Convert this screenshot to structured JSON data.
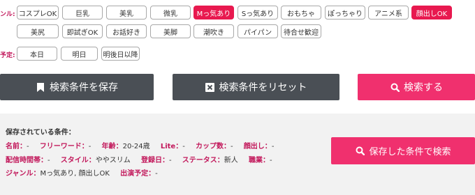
{
  "genre_label": "ンル:",
  "genre_chips": [
    {
      "label": "コスプレOK",
      "selected": false
    },
    {
      "label": "巨乳",
      "selected": false
    },
    {
      "label": "美乳",
      "selected": false
    },
    {
      "label": "微乳",
      "selected": false
    },
    {
      "label": "Mっ気あり",
      "selected": true
    },
    {
      "label": "Sっ気あり",
      "selected": false
    },
    {
      "label": "おもちゃ",
      "selected": false
    },
    {
      "label": "ぽっちゃり",
      "selected": false
    },
    {
      "label": "アニメ系",
      "selected": false
    },
    {
      "label": "顔出しOK",
      "selected": true
    },
    {
      "label": "美尻",
      "selected": false
    },
    {
      "label": "即試ぎOK",
      "selected": false
    },
    {
      "label": "お話好き",
      "selected": false
    },
    {
      "label": "美脚",
      "selected": false
    },
    {
      "label": "潮吹き",
      "selected": false
    },
    {
      "label": "パイパン",
      "selected": false
    },
    {
      "label": "待合せ歓迎",
      "selected": false
    }
  ],
  "schedule_label": "予定:",
  "schedule_chips": [
    {
      "label": "本日"
    },
    {
      "label": "明日"
    },
    {
      "label": "明後日以降"
    }
  ],
  "buttons": {
    "save": "検索条件を保存",
    "reset": "検索条件をリセット",
    "search": "検索する",
    "search_saved": "保存した条件で検索"
  },
  "saved": {
    "title": "保存されている条件：",
    "line1": [
      {
        "k": "名前：",
        "v": "-"
      },
      {
        "k": "フリーワード：",
        "v": "-"
      },
      {
        "k": "年齢：",
        "v": "20-24歳"
      },
      {
        "k": "Lite：",
        "v": "-"
      },
      {
        "k": "カップ数：",
        "v": "-"
      },
      {
        "k": "顔出し：",
        "v": "-"
      }
    ],
    "line2": [
      {
        "k": "配信時間帯：",
        "v": "-"
      },
      {
        "k": "スタイル：",
        "v": "ややスリム"
      },
      {
        "k": "登録日：",
        "v": "-"
      },
      {
        "k": "ステータス：",
        "v": "新人"
      },
      {
        "k": "職業：",
        "v": "-"
      }
    ],
    "line3": [
      {
        "k": "ジャンル：",
        "v": "Mっ気あり, 顔出しOK"
      },
      {
        "k": "出演予定：",
        "v": "-"
      }
    ]
  },
  "colors": {
    "selected": "#e8194f",
    "accent_pink": "#f0306e",
    "dark_button": "#4a4f55",
    "label_pink": "#c2185b"
  },
  "icons": {
    "save": "bookmark-icon",
    "reset": "close-box-icon",
    "search": "search-icon"
  }
}
